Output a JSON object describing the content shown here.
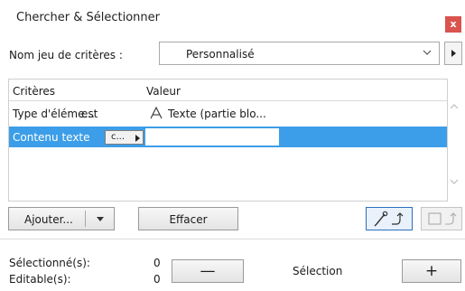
{
  "window": {
    "title": "Chercher & Sélectionner",
    "close_label": "x"
  },
  "criteria_set": {
    "label": "Nom jeu de critères :",
    "value": "Personnalisé"
  },
  "table": {
    "headers": {
      "criteria": "Critères",
      "value": "Valeur"
    },
    "rows": [
      {
        "criteria": "Type d'éléme...",
        "operator": "est",
        "value": "Texte (partie blo..."
      },
      {
        "criteria": "Contenu texte",
        "operator": "c...",
        "value": ""
      }
    ]
  },
  "buttons": {
    "add": "Ajouter...",
    "clear": "Effacer"
  },
  "status": {
    "selected_label": "Sélectionné(s):",
    "selected_count": "0",
    "editable_label": "Editable(s):",
    "editable_count": "0"
  },
  "selection": {
    "label": "Sélection",
    "remove": "—",
    "add": "+"
  },
  "colors": {
    "selection": "#3c9ee8",
    "close": "#d9534f",
    "active_tool": "#2c6fbf"
  },
  "icons": [
    "close-icon",
    "chevron-down-icon",
    "chevron-right-icon",
    "text-icon",
    "scroll-up-icon",
    "scroll-down-icon",
    "pick-up-icon",
    "marquee-icon"
  ]
}
